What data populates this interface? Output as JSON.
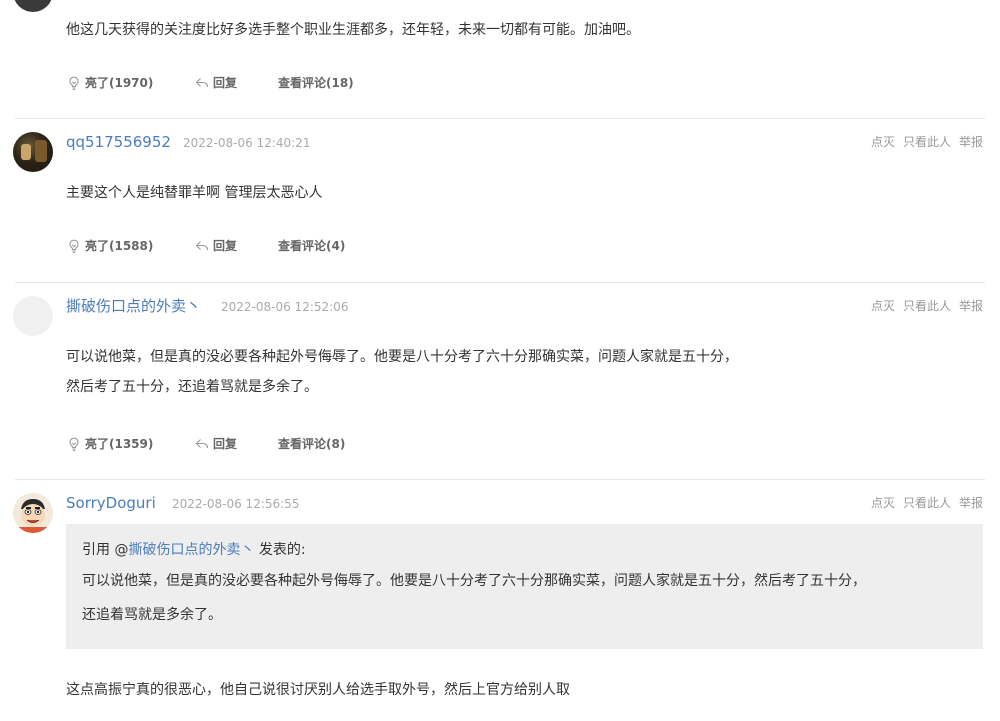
{
  "comments": [
    {
      "id": 0,
      "text_lines": [
        "他这几天获得的关注度比好多选手整个职业生涯都多，还年轻，未来一切都有可能。加油吧。"
      ],
      "likes": "亮了(1970)",
      "reply": "回复",
      "view_replies": "查看评论(18)"
    },
    {
      "id": 1,
      "username": "qq517556952",
      "timestamp": "2022-08-06 12:40:21",
      "text_lines": [
        "主要这个人是纯替罪羊啊 管理层太恶心人"
      ],
      "likes": "亮了(1588)",
      "reply": "回复",
      "view_replies": "查看评论(4)"
    },
    {
      "id": 2,
      "username": "撕破伤口点的外卖丶",
      "timestamp": "2022-08-06 12:52:06",
      "text_lines": [
        "可以说他菜，但是真的没必要各种起外号侮辱了。他要是八十分考了六十分那确实菜，问题人家就是五十分，",
        "然后考了五十分，还追着骂就是多余了。"
      ],
      "likes": "亮了(1359)",
      "reply": "回复",
      "view_replies": "查看评论(8)"
    },
    {
      "id": 3,
      "username": "SorryDoguri",
      "timestamp": "2022-08-06 12:56:55",
      "quote": {
        "prefix": "引用 @",
        "user": "撕破伤口点的外卖丶",
        "suffix": " 发表的:",
        "lines": [
          "可以说他菜，但是真的没必要各种起外号侮辱了。他要是八十分考了六十分那确实菜，问题人家就是五十分，然后考了五十分，",
          "还追着骂就是多余了。"
        ]
      },
      "text_lines": [
        "这点高振宁真的很恶心，他自己说很讨厌别人给选手取外号，然后上官方给别人取"
      ]
    }
  ],
  "actions": {
    "light_off": "点灭",
    "only_view": "只看此人",
    "report": "举报"
  },
  "colors": {
    "username": "#4a7dbd",
    "timestamp": "#aaaaaa",
    "text": "#333333",
    "quote_bg": "#eeeeee",
    "divider": "#e8e8e8"
  },
  "icons": {
    "like": "lightbulb-icon",
    "reply": "reply-arrow-icon"
  }
}
